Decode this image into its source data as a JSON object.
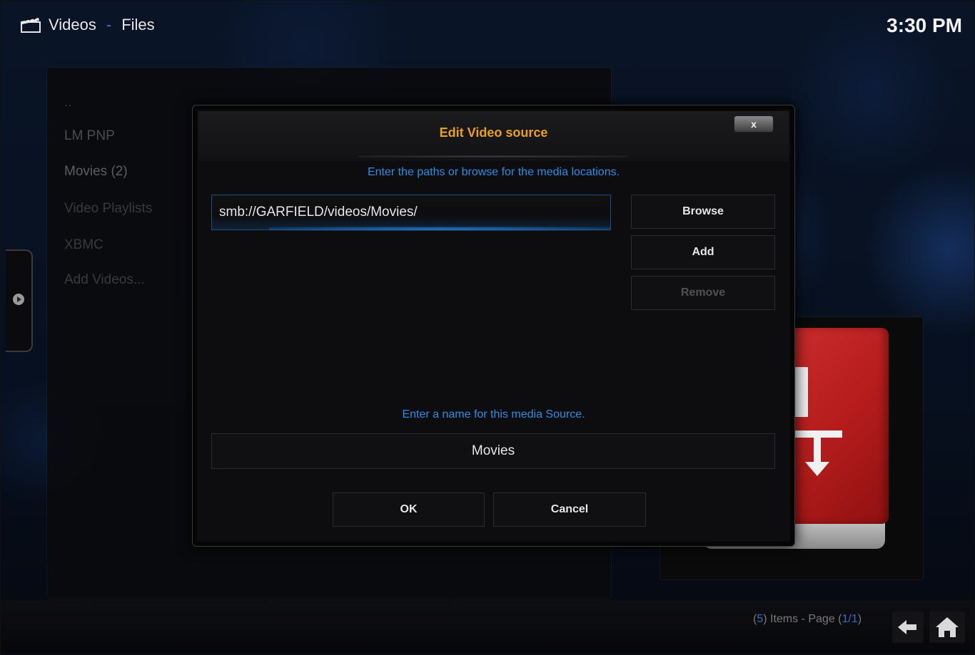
{
  "header": {
    "title": "Videos",
    "separator": "-",
    "subtitle": "Files",
    "clock": "3:30 PM"
  },
  "list": {
    "items": [
      {
        "label": ".."
      },
      {
        "label": "LM PNP"
      },
      {
        "label": "Movies (2)"
      },
      {
        "label": "Video Playlists"
      },
      {
        "label": "XBMC"
      },
      {
        "label": "Add Videos..."
      }
    ]
  },
  "dialog": {
    "title": "Edit Video source",
    "close_label": "x",
    "paths_prompt": "Enter the paths or browse for the media locations.",
    "path_value": "smb://GARFIELD/videos/Movies/",
    "browse_label": "Browse",
    "add_label": "Add",
    "remove_label": "Remove",
    "name_prompt": "Enter a name for this media Source.",
    "name_value": "Movies",
    "ok_label": "OK",
    "cancel_label": "Cancel"
  },
  "footer": {
    "items_count": "5",
    "items_text_pre": "(",
    "items_text_mid": ") Items - Page (",
    "page": "1/1",
    "items_text_post": ")"
  },
  "icons": {
    "header_icon": "clapperboard-icon",
    "side_tab_icon": "chevron-right-icon",
    "back_icon": "back-arrow-icon",
    "home_icon": "home-icon"
  },
  "colors": {
    "accent_blue": "#2d8de6",
    "title_orange": "#e9a11a",
    "text_light": "#e6e6e6"
  }
}
